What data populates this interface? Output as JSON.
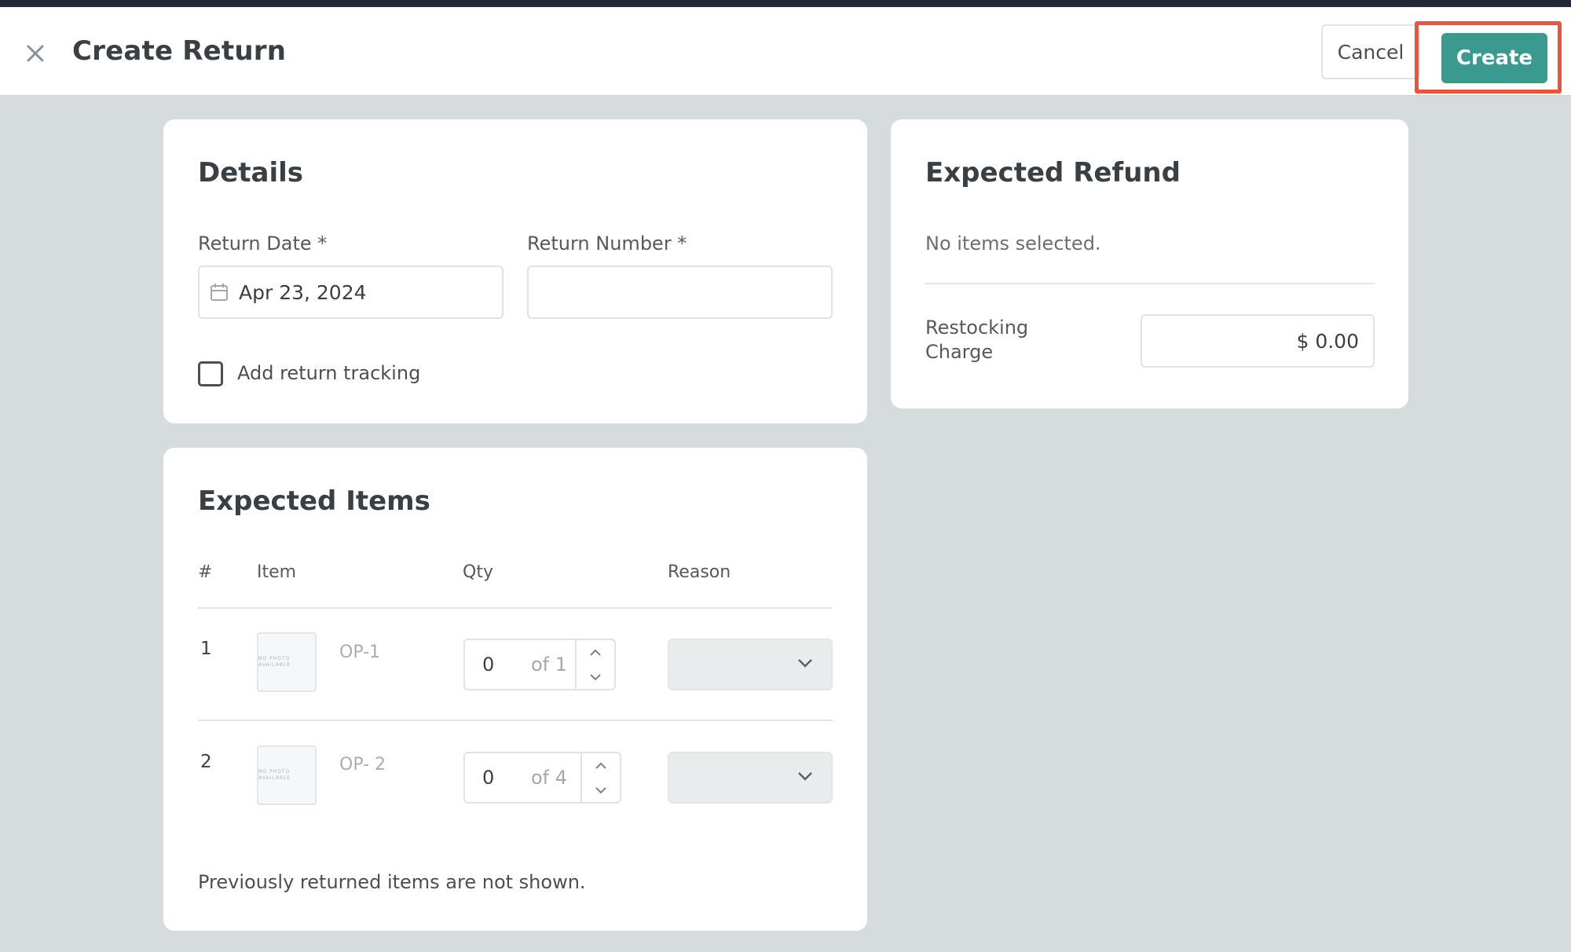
{
  "header": {
    "title": "Create Return",
    "cancel_label": "Cancel",
    "create_label": "Create"
  },
  "details": {
    "title": "Details",
    "return_date_label": "Return Date *",
    "return_date_value": "Apr 23, 2024",
    "return_number_label": "Return Number *",
    "return_number_value": "",
    "tracking_label": "Add return tracking",
    "tracking_checked": false
  },
  "refund": {
    "title": "Expected Refund",
    "empty_text": "No items selected.",
    "restocking_label": "Restocking Charge",
    "restocking_value": "$ 0.00"
  },
  "items": {
    "title": "Expected Items",
    "columns": [
      "#",
      "Item",
      "Qty",
      "Reason"
    ],
    "rows": [
      {
        "num": "1",
        "thumb_text": "NO PHOTO AVAILABLE",
        "sku": "OP-1",
        "qty": "0",
        "of": "of 1",
        "reason": ""
      },
      {
        "num": "2",
        "thumb_text": "NO PHOTO AVAILABLE",
        "sku": "OP- 2",
        "qty": "0",
        "of": "of 4",
        "reason": ""
      }
    ],
    "footer_note": "Previously returned items are not shown."
  },
  "colors": {
    "accent": "#3b9a8f",
    "highlight": "#e7553e",
    "background": "#d6dbdd"
  },
  "icons": {
    "close": "close-icon",
    "calendar": "calendar-icon",
    "chevron": "chevron-down-icon"
  }
}
